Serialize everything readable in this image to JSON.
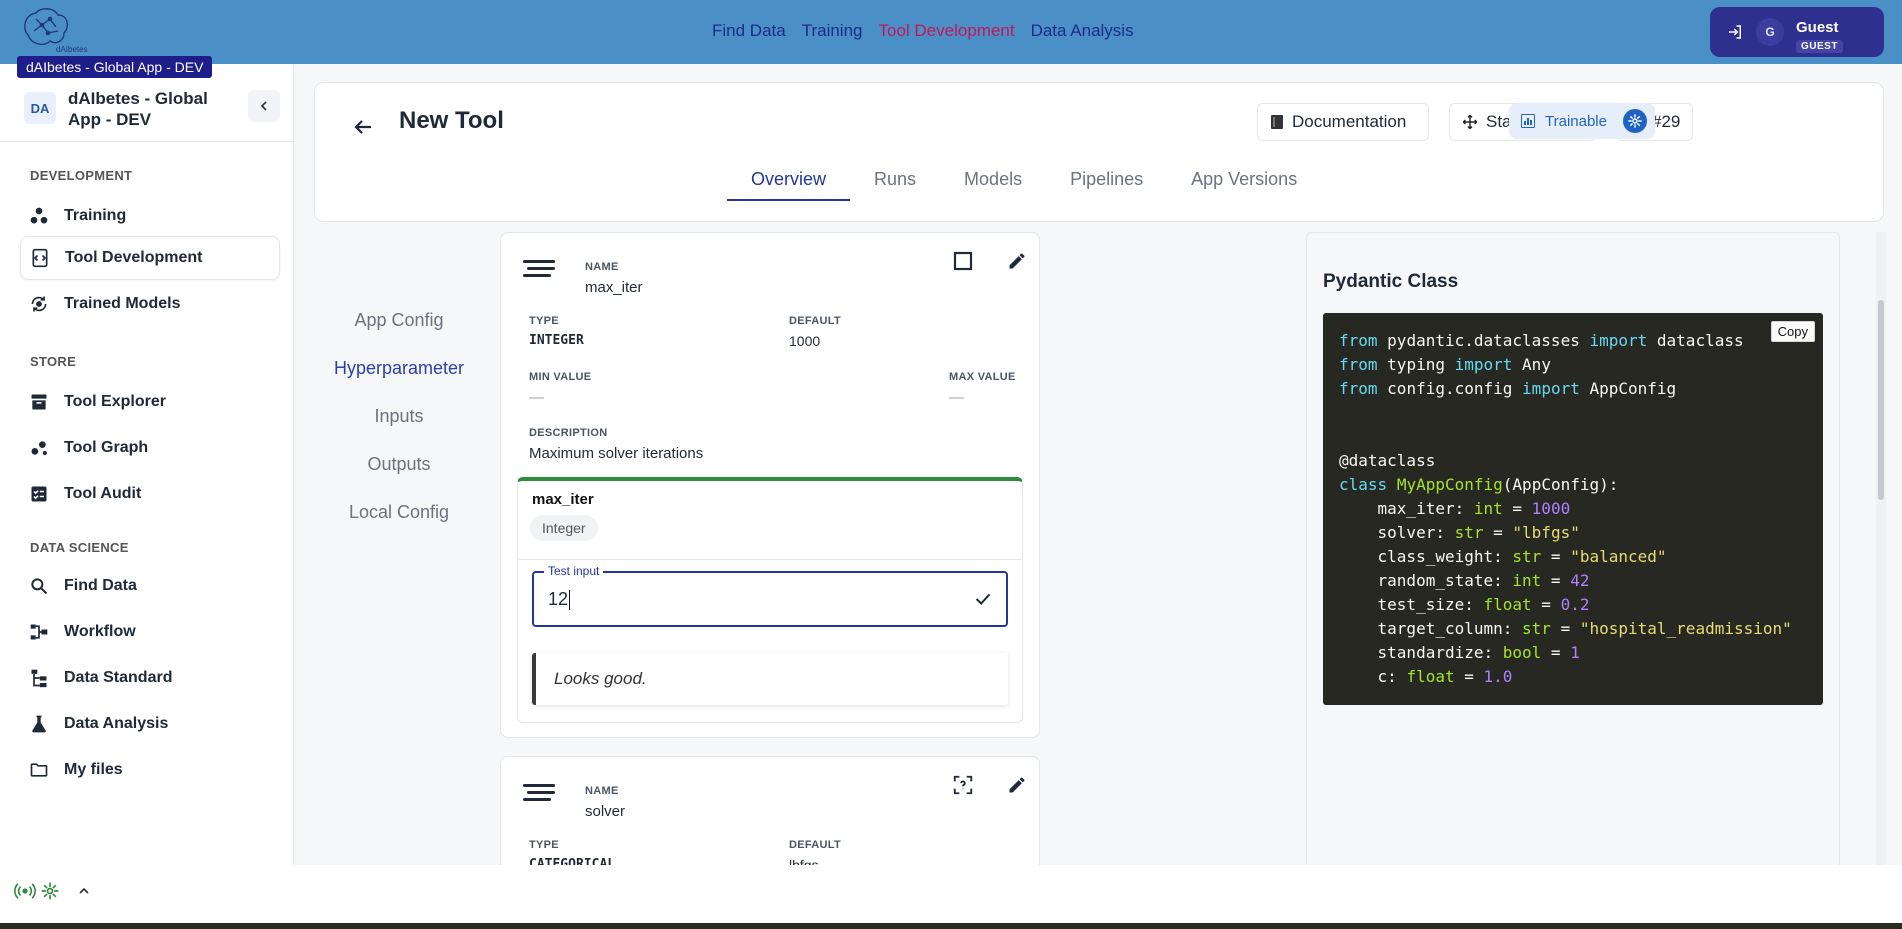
{
  "app": {
    "logo_text": "dAIbetes",
    "tooltip": "dAIbetes - Global App - DEV"
  },
  "topnav": {
    "items": [
      "Find Data",
      "Training",
      "Tool Development",
      "Data Analysis"
    ],
    "active": "Tool Development"
  },
  "user": {
    "avatar_letter": "G",
    "name": "Guest",
    "role": "GUEST"
  },
  "sidebar": {
    "badge": "DA",
    "title": "dAIbetes - Global App - DEV",
    "sections": [
      {
        "title": "DEVELOPMENT",
        "items": [
          {
            "label": "Training",
            "icon": "training-icon"
          },
          {
            "label": "Tool Development",
            "icon": "tool-development-icon",
            "active": true
          },
          {
            "label": "Trained Models",
            "icon": "trained-models-icon"
          }
        ]
      },
      {
        "title": "STORE",
        "items": [
          {
            "label": "Tool Explorer",
            "icon": "archive-icon"
          },
          {
            "label": "Tool Graph",
            "icon": "graph-icon"
          },
          {
            "label": "Tool Audit",
            "icon": "checklist-icon"
          }
        ]
      },
      {
        "title": "DATA SCIENCE",
        "items": [
          {
            "label": "Find Data",
            "icon": "search-icon"
          },
          {
            "label": "Workflow",
            "icon": "workflow-icon"
          },
          {
            "label": "Data Standard",
            "icon": "hierarchy-icon"
          },
          {
            "label": "Data Analysis",
            "icon": "flask-icon"
          },
          {
            "label": "My files",
            "icon": "folder-icon"
          }
        ]
      }
    ]
  },
  "tool": {
    "title": "New Tool",
    "documentation_label": "Documentation",
    "start_coding_label": "Start coding",
    "id_label": "#29",
    "trainable_label": "Trainable"
  },
  "tabs": [
    "Overview",
    "Runs",
    "Models",
    "Pipelines",
    "App Versions"
  ],
  "active_tab": "Overview",
  "subnav": [
    "App Config",
    "Hyperparameter",
    "Inputs",
    "Outputs",
    "Local Config"
  ],
  "active_subnav": "Hyperparameter",
  "params": [
    {
      "name_label": "NAME",
      "name": "max_iter",
      "type_label": "TYPE",
      "type": "INTEGER",
      "default_label": "DEFAULT",
      "default": "1000",
      "min_label": "MIN VALUE",
      "min": "—",
      "max_label": "MAX VALUE",
      "max": "—",
      "description_label": "DESCRIPTION",
      "description": "Maximum solver iterations"
    },
    {
      "name_label": "NAME",
      "name": "solver",
      "type_label": "TYPE",
      "type": "CATEGORICAL",
      "default_label": "DEFAULT",
      "default": "lbfgs"
    }
  ],
  "test_panel": {
    "name": "max_iter",
    "type_chip": "Integer",
    "input_label": "Test input",
    "input_value": "12",
    "message": "Looks good."
  },
  "pydantic": {
    "title": "Pydantic Class",
    "copy_label": "Copy",
    "code_lines": [
      "from pydantic.dataclasses import dataclass",
      "from typing import Any",
      "from config.config import AppConfig",
      "",
      "",
      "@dataclass",
      "class MyAppConfig(AppConfig):",
      "    max_iter: int = 1000",
      "    solver: str = \"lbfgs\"",
      "    class_weight: str = \"balanced\"",
      "    random_state: int = 42",
      "    test_size: float = 0.2",
      "    target_column: str = \"hospital_readmission\"",
      "    standardize: bool = 1",
      "    c: float = 1.0"
    ]
  },
  "colors": {
    "topbar": "#4a8fc6",
    "nav_link": "#1f2a8a",
    "nav_active": "#c2185b",
    "accent": "#23369a",
    "success": "#2e8b3e",
    "code_bg": "#272822"
  }
}
